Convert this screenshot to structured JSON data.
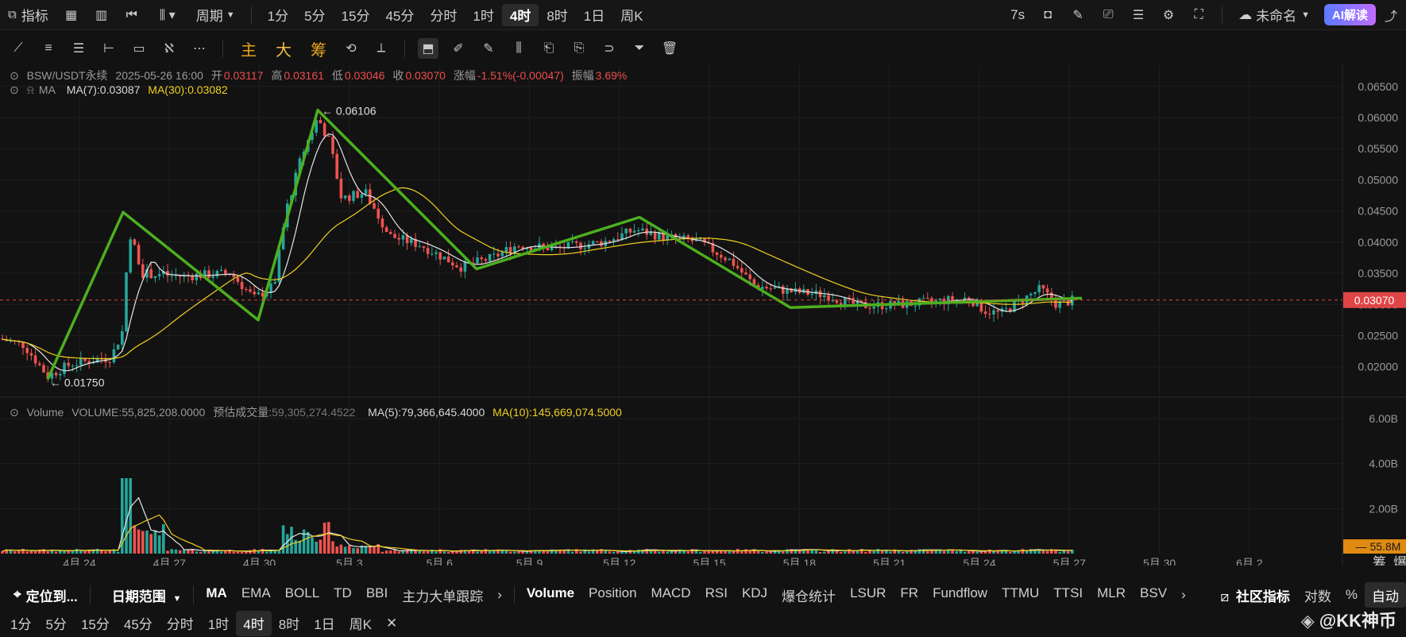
{
  "topbar": {
    "indicators_label": "指标",
    "period_label": "周期",
    "timeframes": [
      "1分",
      "5分",
      "15分",
      "45分",
      "分时",
      "1时",
      "4时",
      "8时",
      "1日",
      "周K"
    ],
    "active_timeframe": "4时",
    "refresh_label": "7s",
    "layout_name": "未命名",
    "ai_label": "AI解读"
  },
  "drawbar": {
    "tool_main": "主",
    "tool_big": "大",
    "tool_chip": "筹"
  },
  "ohlc": {
    "symbol": "BSW/USDT永续",
    "datetime": "2025-05-26 16:00",
    "open_label": "开",
    "open": "0.03117",
    "high_label": "高",
    "high": "0.03161",
    "low_label": "低",
    "low": "0.03046",
    "close_label": "收",
    "close": "0.03070",
    "change_label": "涨幅",
    "change": "-1.51%(-0.00047)",
    "amp_label": "振幅",
    "amp": "3.69%"
  },
  "ma_legend": {
    "name": "MA",
    "ma7": "MA(7):0.03087",
    "ma30": "MA(30):0.03082"
  },
  "volume_legend": {
    "name": "Volume",
    "volume": "VOLUME:55,825,208.0000",
    "est_label": "预估成交量:",
    "est": "59,305,274.4522",
    "ma5": "MA(5):79,366,645.4000",
    "ma10": "MA(10):145,669,074.5000"
  },
  "price_axis": [
    "0.06500",
    "0.06000",
    "0.05500",
    "0.05000",
    "0.04500",
    "0.04000",
    "0.03500",
    "0.03000",
    "0.02500",
    "0.02000"
  ],
  "current_price": "0.03070",
  "volume_axis": [
    "6.00B",
    "4.00B",
    "2.00B"
  ],
  "current_volume": "55.8M",
  "date_axis": [
    "4月 24",
    "4月 27",
    "4月 30",
    "5月 3",
    "5月 6",
    "5月 9",
    "5月 12",
    "5月 15",
    "5月 18",
    "5月 21",
    "5月 24",
    "5月 27",
    "5月 30",
    "6月 2"
  ],
  "high_marker": "0.06106",
  "low_marker": "0.01750",
  "axis_corner": {
    "chip": "筹",
    "burst": "爆"
  },
  "bottom1": {
    "locate": "定位到...",
    "date_range": "日期范围",
    "main_indicators": [
      "MA",
      "EMA",
      "BOLL",
      "TD",
      "BBI",
      "主力大单跟踪"
    ],
    "sub_indicators": [
      "Volume",
      "Position",
      "MACD",
      "RSI",
      "KDJ",
      "爆仓统计",
      "LSUR",
      "FR",
      "Fundflow",
      "TTMU",
      "TTSI",
      "MLR",
      "BSV"
    ],
    "community": "社区指标",
    "log": "对数",
    "percent": "%",
    "auto": "自动"
  },
  "bottom2": {
    "timeframes": [
      "1分",
      "5分",
      "15分",
      "45分",
      "分时",
      "1时",
      "4时",
      "8时",
      "1日",
      "周K"
    ],
    "active": "4时",
    "close": "✕"
  },
  "watermark": "@KK神币",
  "chart_data": {
    "type": "line",
    "title": "BSW/USDT永续",
    "ylim": [
      0.0155,
      0.0665
    ],
    "x": [
      "4月 24",
      "4月 27",
      "4月 30",
      "5月 3",
      "5月 6",
      "5月 9",
      "5月 12",
      "5月 15",
      "5月 18",
      "5月 21",
      "5月 24",
      "5月 27"
    ],
    "series": [
      {
        "name": "MA(7)",
        "values": [
          0.021,
          0.0345,
          0.0318,
          0.051,
          0.0365,
          0.0392,
          0.042,
          0.0382,
          0.0325,
          0.03,
          0.0298,
          0.0309
        ]
      },
      {
        "name": "MA(30)",
        "values": [
          0.0175,
          0.025,
          0.031,
          0.039,
          0.042,
          0.0385,
          0.0395,
          0.0385,
          0.0355,
          0.0313,
          0.03,
          0.0308
        ]
      }
    ],
    "annotations": [
      {
        "label": "0.06106",
        "x": "5月 2",
        "y": 0.06106
      },
      {
        "label": "0.01750",
        "x": "4月 23",
        "y": 0.0175
      }
    ]
  }
}
